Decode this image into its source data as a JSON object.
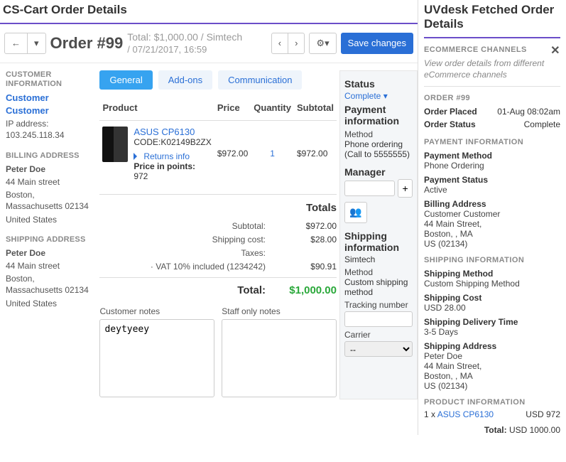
{
  "left": {
    "heading": "CS-Cart Order Details",
    "order_title": "Order #99",
    "meta_top": "Total: $1,000.00 / Simtech",
    "meta_bottom": "/ 07/21/2017, 16:59",
    "save_btn": "Save changes",
    "tabs": {
      "general": "General",
      "addons": "Add-ons",
      "comm": "Communication"
    },
    "sidebar": {
      "cust_h": "CUSTOMER INFORMATION",
      "cust_link": "Customer Customer",
      "ip_lbl": "IP address:",
      "ip": "103.245.118.34",
      "bill_h": "BILLING ADDRESS",
      "ship_h": "SHIPPING ADDRESS",
      "addr_name": "Peter Doe",
      "addr_l1": "44 Main street",
      "addr_l2": "Boston, Massachusetts 02134",
      "addr_l3": "United States"
    },
    "thead": {
      "product": "Product",
      "price": "Price",
      "qty": "Quantity",
      "sub": "Subtotal"
    },
    "product": {
      "name": "ASUS CP6130",
      "code_lbl": "CODE:",
      "code": "K02149B2ZX",
      "returns": "Returns info",
      "points_lbl": "Price in points:",
      "points": "972",
      "price": "$972.00",
      "qty": "1",
      "sub": "$972.00"
    },
    "totals": {
      "h": "Totals",
      "subtotal_l": "Subtotal:",
      "subtotal_v": "$972.00",
      "ship_l": "Shipping cost:",
      "ship_v": "$28.00",
      "tax_l": "Taxes:",
      "tax_v": "",
      "vat_l": "· VAT 10% included (1234242)",
      "vat_v": "$90.91",
      "total_l": "Total:",
      "total_v": "$1,000.00"
    },
    "notes": {
      "cust_l": "Customer notes",
      "cust_v": "deytyeey",
      "staff_l": "Staff only notes",
      "staff_v": ""
    },
    "sidecol": {
      "status_h": "Status",
      "status_v": "Complete",
      "payinfo_h": "Payment information",
      "method_l": "Method",
      "method_v": "Phone ordering (Call to 5555555)",
      "manager_h": "Manager",
      "shipinfo_h": "Shipping information",
      "ship_vendor": "Simtech",
      "ship_method_l": "Method",
      "ship_method_v": "Custom shipping method",
      "track_l": "Tracking number",
      "carrier_l": "Carrier",
      "carrier_v": "--"
    }
  },
  "right": {
    "heading": "UVdesk Fetched Order Details",
    "channels_h": "ECOMMERCE CHANNELS",
    "channels_sub": "View order details from different eCommerce channels",
    "order_h": "ORDER #99",
    "placed_l": "Order Placed",
    "placed_v": "01-Aug 08:02am",
    "status_l": "Order Status",
    "status_v": "Complete",
    "pay_h": "PAYMENT INFORMATION",
    "pay_method_l": "Payment Method",
    "pay_method_v": "Phone Ordering",
    "pay_status_l": "Payment Status",
    "pay_status_v": "Active",
    "bill_l": "Billing Address",
    "bill_v1": "Customer Customer",
    "bill_v2": "44 Main Street,",
    "bill_v3": "Boston, , MA",
    "bill_v4": "US (02134)",
    "ship_h": "SHIPPING INFORMATION",
    "ship_method_l": "Shipping Method",
    "ship_method_v": "Custom Shipping Method",
    "ship_cost_l": "Shipping Cost",
    "ship_cost_v": "USD 28.00",
    "ship_del_l": "Shipping Delivery Time",
    "ship_del_v": "3-5 Days",
    "ship_addr_l": "Shipping Address",
    "ship_v1": "Peter Doe",
    "ship_v2": "44 Main Street,",
    "ship_v3": "Boston, , MA",
    "ship_v4": "US (02134)",
    "prod_h": "PRODUCT INFORMATION",
    "prod_qty": "1 x ",
    "prod_name": "ASUS CP6130",
    "prod_price": "USD 972",
    "total_l": "Total:",
    "total_v": "USD 1000.00"
  }
}
